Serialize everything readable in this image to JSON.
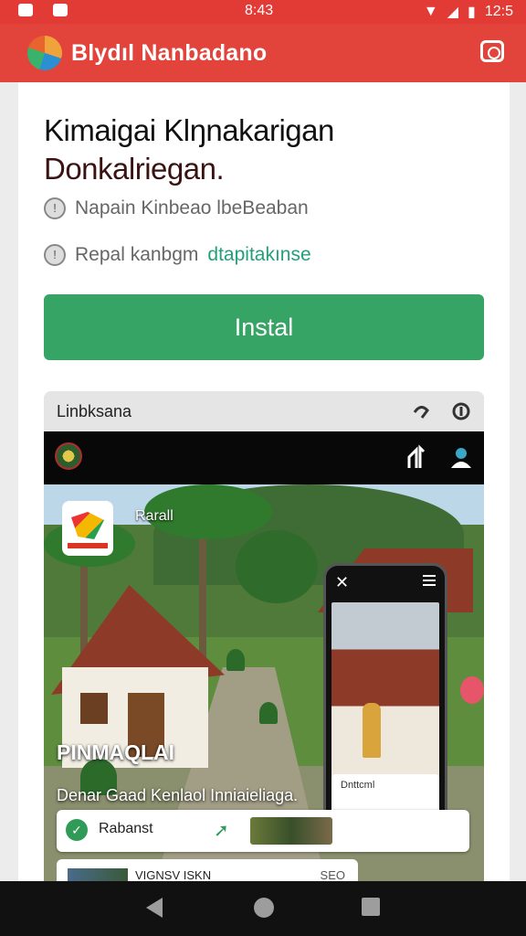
{
  "status_bar": {
    "time": "8:43",
    "clock_right": "12:5",
    "colors": {
      "bar": "#e23b36"
    }
  },
  "app_bar": {
    "title": "Blydıl Nanbadano",
    "icons": [
      "app-logo",
      "camera-icon"
    ]
  },
  "content": {
    "heading_line1": "Kimaigai Klŋnakarigan",
    "heading_line2": "Donkalriegan.",
    "info1": "Napain Kinbeao lbeBeaban",
    "info2_prefix": "Repal kanbgm",
    "info2_green": "dtapitakınse",
    "install_label": "Instal",
    "colors": {
      "install": "#35a464",
      "accent_green": "#22a079"
    }
  },
  "preview": {
    "header_title": "Linbksana",
    "scene_label": "Rarall",
    "badge_text": "PINMAQLAI",
    "caption": "Denar Gaad Kenlaol Inniaieliaga.",
    "card1_label": "Rabanst",
    "card2_label": "VIGNSV ISKN",
    "card2_number": "SEO",
    "phone_sheet_label": "Dnttcml"
  },
  "nav": {
    "buttons": [
      "back",
      "home",
      "recent"
    ]
  }
}
